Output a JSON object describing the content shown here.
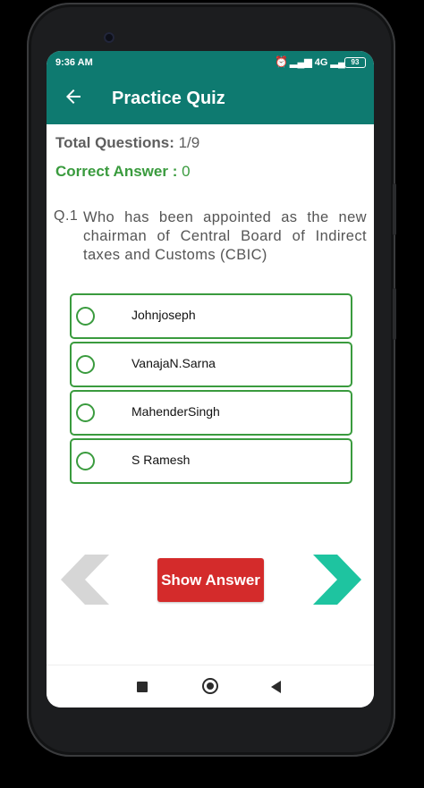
{
  "status_bar": {
    "time": "9:36 AM",
    "network": "4G",
    "battery": "93",
    "alarm_icon": "alarm-clock-icon",
    "signal_icon": "signal-icon"
  },
  "app_bar": {
    "title": "Practice Quiz",
    "back_icon": "arrow-back-icon"
  },
  "quiz": {
    "total_label": "Total Questions:",
    "total_value": " 1/9",
    "correct_label": "Correct Answer :",
    "correct_value": " 0",
    "question_number": "Q.1",
    "question_text": "Who has been appointed as the new chairman of Central Board of Indirect taxes and Customs (CBIC)",
    "options": [
      {
        "label": "Johnjoseph"
      },
      {
        "label": "VanajaN.Sarna"
      },
      {
        "label": "MahenderSingh"
      },
      {
        "label": "S Ramesh"
      }
    ],
    "show_answer_label": "Show Answer"
  },
  "colors": {
    "primary": "#0e7a70",
    "accent_green": "#3a9b3e",
    "button_red": "#d42b2b",
    "next_arrow": "#1ec4a0",
    "prev_arrow": "#d6d6d6"
  }
}
